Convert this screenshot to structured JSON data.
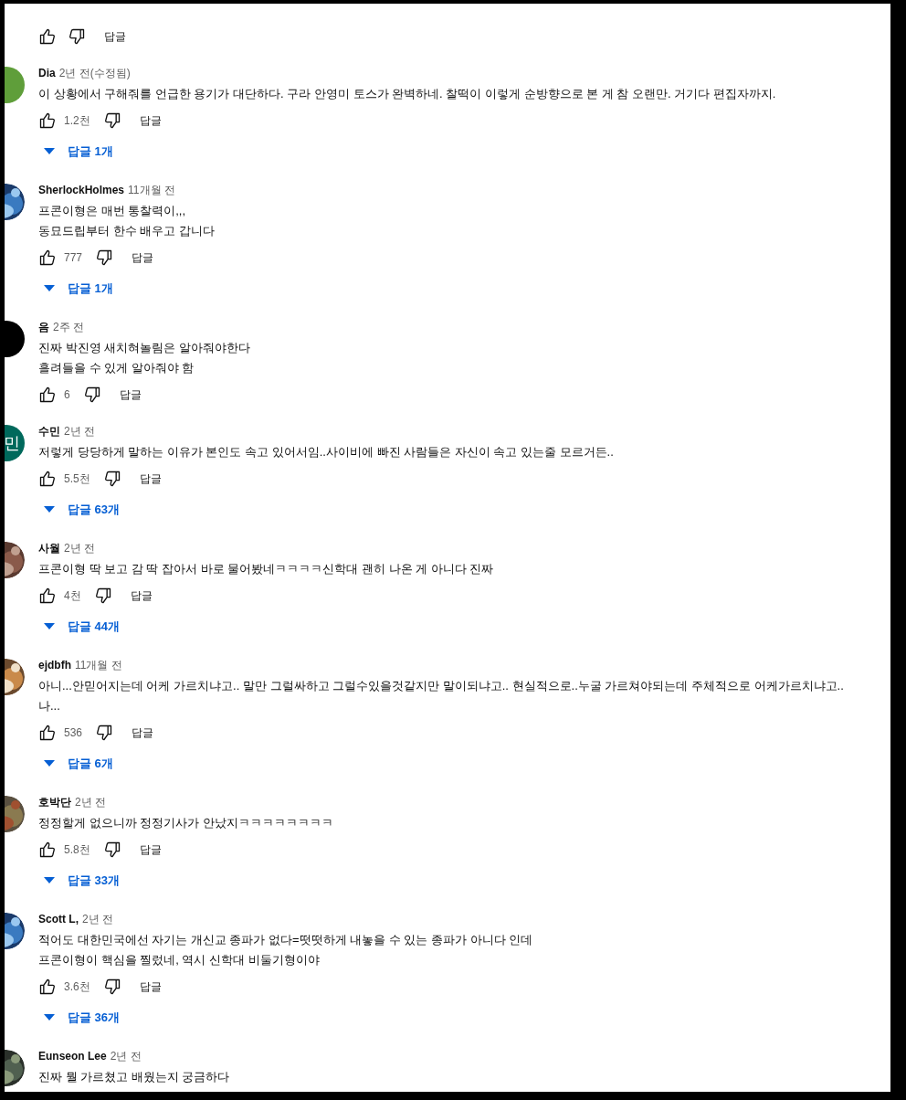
{
  "comments": [
    {
      "reply_label": "답글"
    },
    {
      "author": "Dia",
      "time": "2년 전(수정됨)",
      "avatar": {
        "kind": "plain",
        "color": "#5f9e3a"
      },
      "body": [
        "이 상황에서 구해줘를 언급한 용기가 대단하다. 구라 안영미 토스가 완벽하네. 찰떡이 이렇게 순방향으로 본 게 참 오랜만. 거기다 편집자까지."
      ],
      "likes": "1.2천",
      "reply_label": "답글",
      "replies": "답글 1개"
    },
    {
      "author": "SherlockHolmes",
      "time": "11개월 전",
      "avatar": {
        "kind": "picture"
      },
      "body": [
        "프콘이형은 매번 통찰력이,,,",
        "동묘드립부터 한수 배우고 갑니다"
      ],
      "likes": "777",
      "reply_label": "답글",
      "replies": "답글 1개"
    },
    {
      "author": "음",
      "time": "2주 전",
      "avatar": {
        "kind": "plain",
        "color": "#000000"
      },
      "body": [
        "진짜 박진영 새치혀놀림은 알아줘야한다",
        "흘려들을 수 있게 알아줘야 함"
      ],
      "likes": "6",
      "reply_label": "답글"
    },
    {
      "author": "수민",
      "time": "2년 전",
      "avatar": {
        "kind": "letter",
        "color": "#00695c",
        "letter": "민"
      },
      "body": [
        "저렇게 당당하게 말하는 이유가 본인도 속고 있어서임..사이비에 빠진 사람들은 자신이 속고 있는줄 모르거든.."
      ],
      "likes": "5.5천",
      "reply_label": "답글",
      "replies": "답글 63개"
    },
    {
      "author": "사월",
      "time": "2년 전",
      "avatar": {
        "kind": "picture"
      },
      "body": [
        "프콘이형 딱 보고 감 딱 잡아서 바로 물어봤네ㅋㅋㅋㅋ신학대 괜히 나온 게 아니다 진짜"
      ],
      "likes": "4천",
      "reply_label": "답글",
      "replies": "답글 44개"
    },
    {
      "author": "ejdbfh",
      "time": "11개월 전",
      "avatar": {
        "kind": "picture"
      },
      "body": [
        "아니...안믿어지는데 어케 가르치냐고.. 말만 그럴싸하고 그럴수있을것같지만 말이되냐고.. 현실적으로..누굴 가르쳐야되는데 주체적으로 어케가르치냐고..",
        "나..."
      ],
      "likes": "536",
      "reply_label": "답글",
      "replies": "답글 6개"
    },
    {
      "author": "호박단",
      "time": "2년 전",
      "avatar": {
        "kind": "picture"
      },
      "body": [
        "정정할게 없으니까 정정기사가 안났지ㅋㅋㅋㅋㅋㅋㅋㅋ"
      ],
      "likes": "5.8천",
      "reply_label": "답글",
      "replies": "답글 33개"
    },
    {
      "author": "Scott L,",
      "time": "2년 전",
      "avatar": {
        "kind": "picture"
      },
      "body": [
        "적어도 대한민국에선 자기는 개신교 종파가 없다=떳떳하게 내놓을 수 있는 종파가 아니다 인데",
        "프콘이형이 핵심을 찔렀네, 역시 신학대 비둘기형이야"
      ],
      "likes": "3.6천",
      "reply_label": "답글",
      "replies": "답글 36개"
    },
    {
      "author": "Eunseon Lee",
      "time": "2년 전",
      "avatar": {
        "kind": "picture"
      },
      "body": [
        "진짜 뭘 가르쳤고 배웠는지 궁금하다"
      ]
    }
  ]
}
